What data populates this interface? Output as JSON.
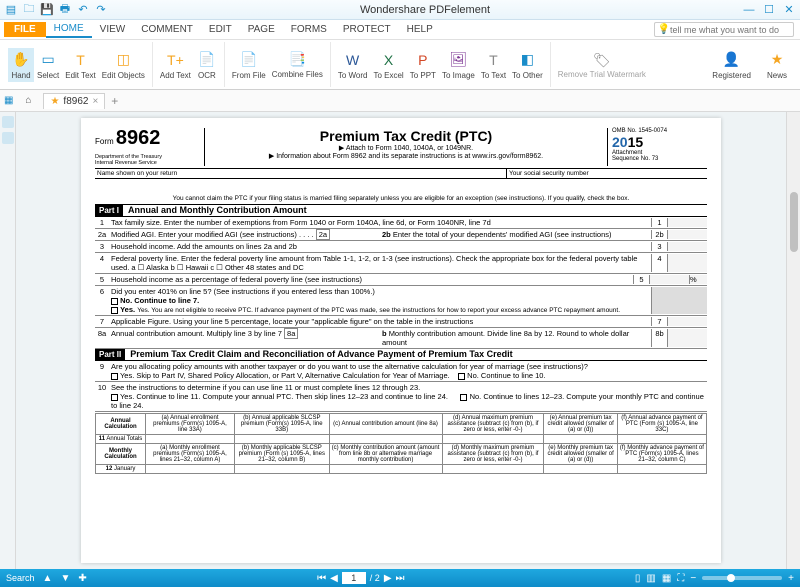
{
  "titlebar": {
    "title": "Wondershare PDFelement"
  },
  "menus": {
    "file": "FILE",
    "home": "HOME",
    "view": "VIEW",
    "comment": "COMMENT",
    "edit": "EDIT",
    "page": "PAGE",
    "forms": "FORMS",
    "protect": "PROTECT",
    "help": "HELP"
  },
  "search": {
    "placeholder": "tell me what you want to do"
  },
  "ribbon": {
    "hand": "Hand",
    "select": "Select",
    "edit_text": "Edit Text",
    "edit_objects": "Edit Objects",
    "add_text": "Add Text",
    "ocr": "OCR",
    "from_file": "From File",
    "combine": "Combine\nFiles",
    "to_word": "To Word",
    "to_excel": "To Excel",
    "to_ppt": "To PPT",
    "to_image": "To Image",
    "to_text": "To Text",
    "to_other": "To Other",
    "remove_wm": "Remove\nTrial Watermark",
    "registered": "Registered",
    "news": "News"
  },
  "tab": {
    "name": "f8962"
  },
  "form": {
    "form_label": "Form",
    "form_no": "8962",
    "dept": "Department of the Treasury\nInternal Revenue Service",
    "title": "Premium Tax Credit (PTC)",
    "attach": "▶ Attach to Form 1040, 1040A, or 1049NR.",
    "info": "▶ Information about Form 8962 and its separate instructions is at www.irs.gov/form8962.",
    "omb": "OMB No. 1545-0074",
    "year": "2015",
    "att": "Attachment",
    "seq": "Sequence No. 73",
    "name_lbl": "Name shown on your return",
    "ssn_lbl": "Your social security number",
    "warn": "You cannot claim the PTC if your filing status is married filing separately unless you are eligible for an exception (see instructions). If you qualify, check the box.",
    "part1": "Part I",
    "part1_t": "Annual and Monthly Contribution Amount",
    "l1": "Tax family size. Enter the number of exemptions from Form 1040 or Form 1040A, line 6d, or Form 1040NR, line 7d",
    "l2a": "Modified AGI. Enter your modified AGI (see instructions)",
    "l2a_box": "2a",
    "l2b": "Enter the total of your dependents' modified AGI (see instructions)",
    "l2b_box": "2b",
    "l3": "Household income. Add the amounts on lines 2a and 2b",
    "l4": "Federal poverty line. Enter the federal poverty line amount from Table 1-1, 1-2, or 1-3 (see instructions). Check the appropriate box for the federal poverty table used.   a ☐ Alaska    b ☐ Hawaii    c ☐ Other 48 states and DC",
    "l5": "Household income as a percentage of federal poverty line (see instructions)",
    "l5_pct": "%",
    "l6": "Did you enter 401% on line 5? (See instructions if you entered less than 100%.)",
    "l6_no": "No. Continue to line 7.",
    "l6_yes": "Yes. You are not eligible to receive PTC. If advance payment of the PTC was made, see the instructions for how to report your excess advance PTC repayment amount.",
    "l7": "Applicable Figure. Using your line 5 percentage, locate your \"applicable figure\" on the table in the instructions",
    "l8a": "Annual contribution amount. Multiply line 3 by line 7",
    "l8a_box": "8a",
    "l8b": "Monthly contribution amount. Divide line 8a by 12. Round to whole dollar amount",
    "l8b_box": "8b",
    "part2": "Part II",
    "part2_t": "Premium Tax Credit Claim and Reconciliation of Advance Payment of Premium Tax Credit",
    "l9": "Are you allocating policy amounts with another taxpayer or do you want to use the alternative calculation for year of marriage (see instructions)?",
    "l9_yes": "Yes. Skip to Part IV, Shared Policy Allocation, or Part V, Alternative Calculation for Year of Marriage.",
    "l9_no": "No. Continue to line 10.",
    "l10": "See the instructions to determine if you can use line 11 or must complete lines 12 through 23.",
    "l10_yes": "Yes. Continue to line 11. Compute your annual PTC. Then skip lines 12–23 and continue to line 24.",
    "l10_no": "No. Continue to lines 12–23. Compute your monthly PTC and continue to line 24.",
    "cols": {
      "a": "(a) Annual enrollment premiums (Form(s) 1095-A, line 33A)",
      "b": "(b) Annual applicable SLCSP premium (Form(s) 1095-A, line 33B)",
      "c": "(c) Annual contribution amount (line 8a)",
      "d": "(d) Annual maximum premium assistance (subtract (c) from (b), if zero or less, enter -0-)",
      "e": "(e) Annual premium tax credit allowed (smaller of (a) or (d))",
      "f": "(f) Annual advance payment of PTC (Form (s) 1095-A, line 33C)",
      "am": "(a) Monthly enrollment premiums (Form(s) 1095-A, lines 21–32, column A)",
      "bm": "(b) Monthly applicable SLCSP premium (Form (s) 1095-A, lines 21–32, column B)",
      "cm": "(c) Monthly contribution amount (amount from line 8b or alternative marriage monthly contribution)",
      "dm": "(d) Monthly maximum premium assistance (subtract (c) from (b), if zero or less, enter -0-)",
      "em": "(e) Monthly premium tax credit allowed (smaller of (a) or (d))",
      "fm": "(f) Monthly advance payment of PTC (Form(s) 1095-A, lines 21–32, column C)"
    },
    "annual_calc": "Annual Calculation",
    "annual_tot": "Annual Totals",
    "monthly_calc": "Monthly Calculation",
    "jan": "January"
  },
  "status": {
    "search": "Search",
    "page": "1",
    "total": "/ 2"
  }
}
